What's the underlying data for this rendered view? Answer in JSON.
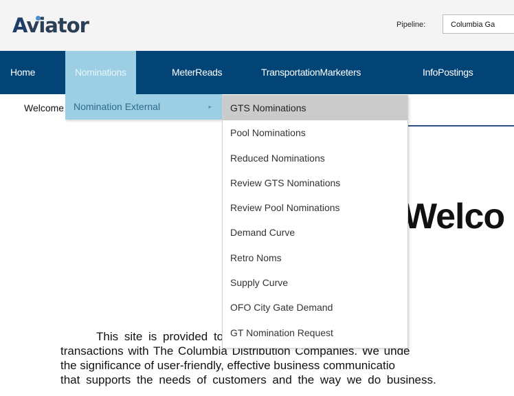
{
  "header": {
    "logo_text_a": "A",
    "logo_text_i": "v",
    "logo_text_rest": "iator",
    "pipeline_label": "Pipeline:",
    "pipeline_value": "Columbia Ga"
  },
  "nav": {
    "items": [
      {
        "label": "Home"
      },
      {
        "label": "Nominations",
        "active": true
      },
      {
        "label": "MeterReads"
      },
      {
        "label": "TransportationMarketers"
      },
      {
        "label": "InfoPostings"
      }
    ]
  },
  "menu": {
    "level1_label": "Nomination External",
    "level1_arrow": "▸",
    "level2_items": [
      {
        "label": "GTS Nominations",
        "highlighted": true
      },
      {
        "label": "Pool Nominations"
      },
      {
        "label": "Reduced Nominations"
      },
      {
        "label": "Review GTS Nominations"
      },
      {
        "label": "Review Pool Nominations"
      },
      {
        "label": "Demand Curve"
      },
      {
        "label": "Retro Noms"
      },
      {
        "label": "Supply Curve"
      },
      {
        "label": "OFO City Gate Demand"
      },
      {
        "label": "GT Nomination Request"
      }
    ]
  },
  "welcome": {
    "strip_text": "Welcome",
    "big_heading": "Welco",
    "intro_lines": [
      "This site is provided to you for the execution of all your",
      "transactions with The Columbia Distribution Companies. We unde",
      "the significance of user-friendly, effective business communicatio",
      "that supports the needs of customers and the way we do business."
    ]
  },
  "colors": {
    "nav_background": "#034477",
    "nav_active": "#9ccfe3",
    "menu_highlight": "#cbcbcb"
  }
}
